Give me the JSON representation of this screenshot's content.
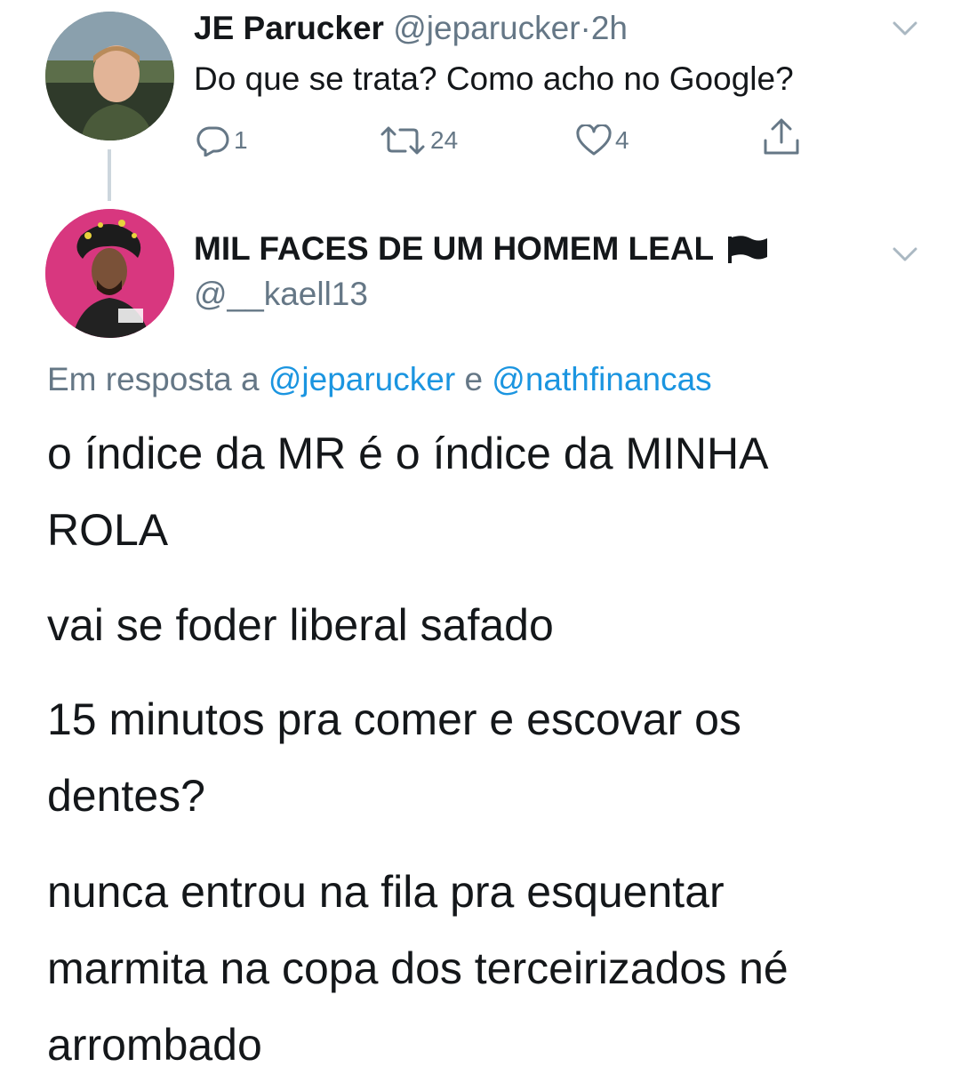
{
  "tweet1": {
    "name": "JE Parucker",
    "handle": "@jeparucker",
    "separator": "·",
    "time": "2h",
    "text": "Do que se trata? Como acho no Google?",
    "actions": {
      "reply_count": "1",
      "retweet_count": "24",
      "like_count": "4"
    }
  },
  "tweet2": {
    "name": "MIL FACES DE UM HOMEM LEAL",
    "handle": "@__kaell13",
    "reply_prefix": "Em resposta a",
    "reply_mention_1": "@jeparucker",
    "reply_conjunction": "e",
    "reply_mention_2": "@nathfinancas",
    "paragraphs": [
      {
        "lines": [
          "o índice da MR é o índice da MINHA",
          "ROLA"
        ]
      },
      {
        "lines": [
          "vai se foder liberal safado"
        ]
      },
      {
        "lines": [
          "15 minutos pra comer e escovar os",
          "dentes?"
        ]
      },
      {
        "lines": [
          "nunca entrou na fila pra esquentar",
          "marmita na copa dos terceirizados né",
          "arrombado"
        ]
      }
    ]
  },
  "colors": {
    "text": "#14171a",
    "muted": "#657786",
    "link": "#1b95e0",
    "avatar2_bg": "#d8377f"
  },
  "icons": [
    "chevron-down-icon",
    "reply-icon",
    "retweet-icon",
    "like-icon",
    "share-icon",
    "black-flag-icon"
  ]
}
